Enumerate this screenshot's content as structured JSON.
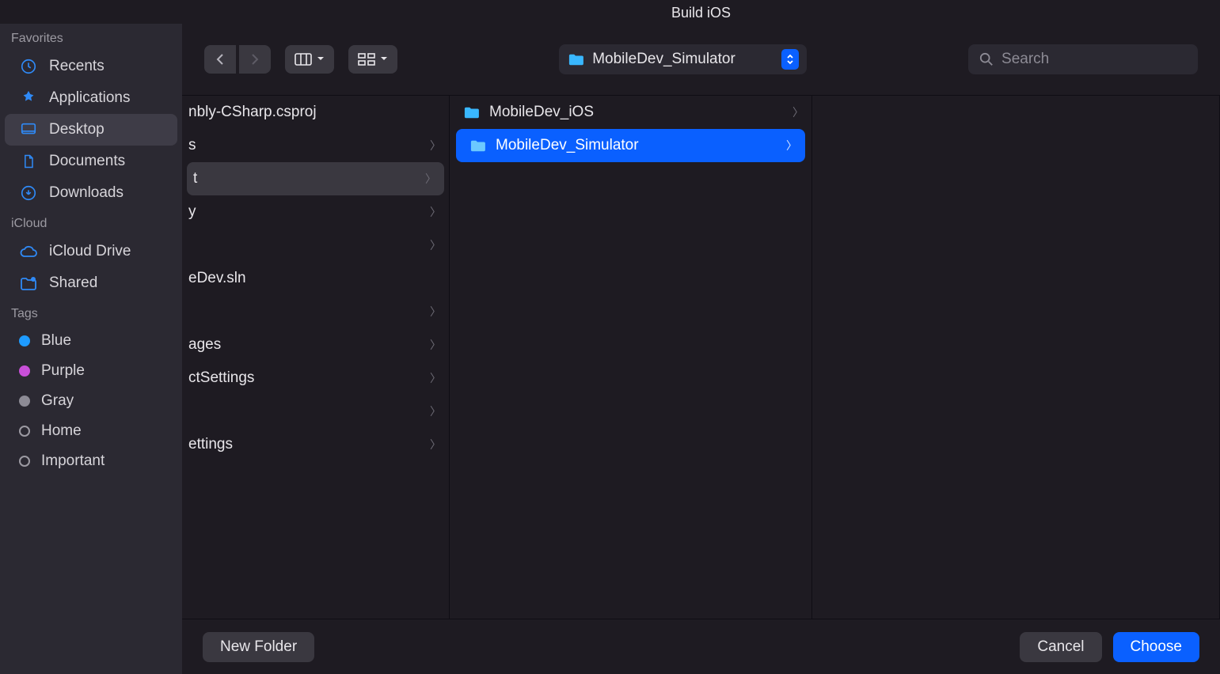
{
  "title": "Build iOS",
  "sidebar": {
    "sections": [
      {
        "title": "Favorites",
        "items": [
          {
            "label": "Recents",
            "icon": "clock-icon"
          },
          {
            "label": "Applications",
            "icon": "apps-icon"
          },
          {
            "label": "Desktop",
            "icon": "desktop-icon",
            "active": true
          },
          {
            "label": "Documents",
            "icon": "document-icon"
          },
          {
            "label": "Downloads",
            "icon": "downloads-icon"
          }
        ]
      },
      {
        "title": "iCloud",
        "items": [
          {
            "label": "iCloud Drive",
            "icon": "cloud-icon"
          },
          {
            "label": "Shared",
            "icon": "shared-folder-icon"
          }
        ]
      },
      {
        "title": "Tags",
        "items": [
          {
            "label": "Blue",
            "tag_color": "#1e9bff"
          },
          {
            "label": "Purple",
            "tag_color": "#c84fd8"
          },
          {
            "label": "Gray",
            "tag_color": "#8d8b95"
          },
          {
            "label": "Home",
            "tag_outline": true
          },
          {
            "label": "Important",
            "tag_outline": true
          }
        ]
      }
    ]
  },
  "toolbar": {
    "path_label": "MobileDev_Simulator",
    "search_placeholder": "Search"
  },
  "columns": {
    "col1": [
      {
        "label": "nbly-CSharp.csproj",
        "chevron": false
      },
      {
        "label": "s",
        "chevron": true
      },
      {
        "label": "t",
        "chevron": true,
        "selected": true
      },
      {
        "label": "y",
        "chevron": true
      },
      {
        "label": "",
        "chevron": true
      },
      {
        "label": "eDev.sln",
        "chevron": false
      },
      {
        "label": "",
        "chevron": true
      },
      {
        "label": "ages",
        "chevron": true
      },
      {
        "label": "ctSettings",
        "chevron": true
      },
      {
        "label": "",
        "chevron": true
      },
      {
        "label": "ettings",
        "chevron": true
      }
    ],
    "col2": [
      {
        "label": "MobileDev_iOS",
        "chevron": true,
        "folder": true
      },
      {
        "label": "MobileDev_Simulator",
        "chevron": true,
        "folder": true,
        "selected": true
      }
    ]
  },
  "footer": {
    "new_folder": "New Folder",
    "cancel": "Cancel",
    "choose": "Choose"
  }
}
